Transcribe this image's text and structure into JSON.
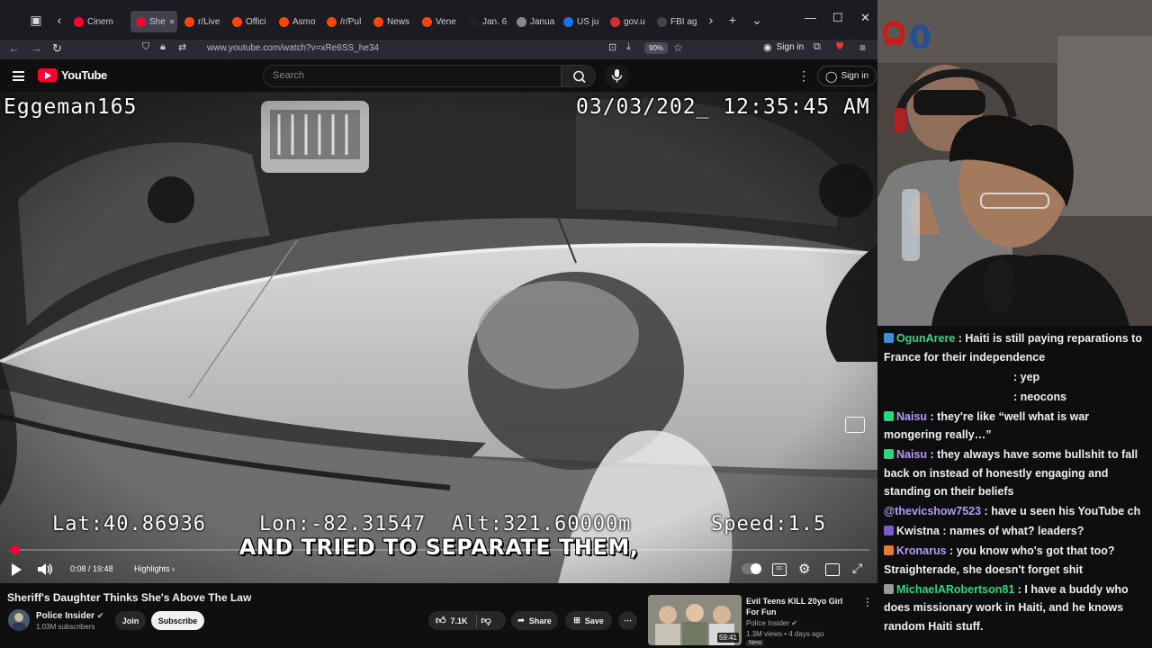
{
  "browser": {
    "tabs": [
      {
        "label": "Cinem",
        "fav": "#ff0033"
      },
      {
        "label": "She",
        "fav": "#ff0033",
        "active": true
      },
      {
        "label": "r/Live",
        "fav": "#ff4500"
      },
      {
        "label": "Offici",
        "fav": "#ff4500"
      },
      {
        "label": "Asmo",
        "fav": "#ff4500"
      },
      {
        "label": "/r/Pul",
        "fav": "#ff4500"
      },
      {
        "label": "News",
        "fav": "#ff4500"
      },
      {
        "label": "Vene",
        "fav": "#ff4500"
      },
      {
        "label": "Jan. 6",
        "fav": "#222"
      },
      {
        "label": "Janua",
        "fav": "#888"
      },
      {
        "label": "US ju",
        "fav": "#1a73e8"
      },
      {
        "label": "gov.u",
        "fav": "#c33"
      },
      {
        "label": "FBI ag",
        "fav": "#444"
      }
    ],
    "active_tab_label": "She",
    "url": "www.youtube.com/watch?v=xRe6SS_he34",
    "zoom": "90%",
    "signin_label": "Sign in",
    "ext_badge": "19"
  },
  "youtube": {
    "logo_text": "YouTube",
    "search_placeholder": "Search",
    "signin_label": "Sign in"
  },
  "video": {
    "osd_user": "Eggeman165",
    "osd_datetime": "03/03/202_ 12:35:45 AM",
    "osd_lat": "Lat:40.86936",
    "osd_lon": "Lon:-82.31547",
    "osd_alt": "Alt:321.60000m",
    "osd_speed": "Speed:1.5",
    "caption": "AND TRIED TO SEPARATE THEM,",
    "time_current": "0:08",
    "time_sep": " / ",
    "time_total": "19:48",
    "chapter": "Highlights",
    "progress": 0.0068
  },
  "info": {
    "title": "Sheriff's Daughter Thinks She's Above The Law",
    "channel": "Police Insider",
    "subscribers": "1.03M subscribers",
    "join_label": "Join",
    "subscribe_label": "Subscribe",
    "likes": "7.1K",
    "share_label": "Share",
    "save_label": "Save"
  },
  "recommendation": {
    "title": "Evil Teens KILL 20yo Girl For Fun",
    "channel": "Police Insider",
    "meta": "1.3M views • 4 days ago",
    "duration": "59:41",
    "badge": "New"
  },
  "stream": {
    "cam_counter": "0"
  },
  "chat": [
    {
      "user": "OgunArere",
      "color": "#2fd680",
      "badge": "#3b8fd6",
      "text": "Haiti is still paying reparations to France for their independence"
    },
    {
      "user": "",
      "color": "#efeff1",
      "badge": "",
      "text": "yep",
      "indent": true
    },
    {
      "user": "",
      "color": "#efeff1",
      "badge": "",
      "text": "neocons",
      "indent": true
    },
    {
      "user": "Naisu",
      "color": "#b89af7",
      "badge": "#2fd680",
      "text": "they're like “well what is war mongering really…”"
    },
    {
      "user": "Naisu",
      "color": "#b89af7",
      "badge": "#2fd680",
      "text": "they always have some bullshit to fall back on instead of honestly engaging and standing on their beliefs"
    },
    {
      "user": "@thevicshow7523",
      "color": "#b89af7",
      "badge": "",
      "text": "have u seen his YouTube ch"
    },
    {
      "user": "Kwistna",
      "color": "#efeff1",
      "badge": "#7a5cc4",
      "text": "names of what? leaders?"
    },
    {
      "user": "Kronarus",
      "color": "#b89af7",
      "badge": "#e07b39",
      "text": "you know who's got that too? Straighterade, she doesn't forget shit"
    },
    {
      "user": "MichaelARobertson81",
      "color": "#2fd680",
      "badge": "#999",
      "text": "I have a buddy who does missionary work in Haiti, and he knows random Haiti stuff."
    }
  ]
}
